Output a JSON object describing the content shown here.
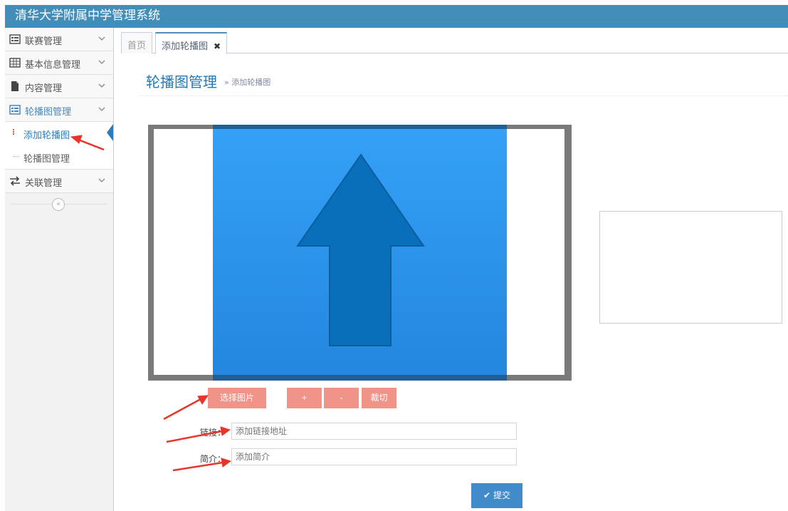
{
  "header": {
    "title": "清华大学附属中学管理系统"
  },
  "sidebar": {
    "items": [
      {
        "label": "联赛管理",
        "icon": "list-alt-icon"
      },
      {
        "label": "基本信息管理",
        "icon": "table-icon"
      },
      {
        "label": "内容管理",
        "icon": "file-icon"
      },
      {
        "label": "轮播图管理",
        "icon": "list-alt-icon"
      },
      {
        "label": "关联管理",
        "icon": "exchange-icon"
      }
    ],
    "submenu": [
      {
        "label": "添加轮播图"
      },
      {
        "label": "轮播图管理"
      }
    ],
    "collapse_glyph": "«"
  },
  "tabs": [
    {
      "label": "首页"
    },
    {
      "label": "添加轮播图",
      "close": "✖"
    }
  ],
  "page": {
    "title": "轮播图管理",
    "subtitle": "» 添加轮播图"
  },
  "toolbar": {
    "choose_label": "选择图片",
    "zoom_in_label": "+",
    "zoom_out_label": "-",
    "crop_label": "裁切"
  },
  "form": {
    "link_label": "链接：",
    "link_placeholder": "添加链接地址",
    "intro_label": "简介：",
    "intro_placeholder": "添加简介",
    "submit_label": "提交",
    "submit_icon": "✔"
  },
  "colors": {
    "header": "#438eb9",
    "accent": "#2b7dbc",
    "button": "#f0948a",
    "submit": "#428bca",
    "annotation": "#e8352b"
  }
}
